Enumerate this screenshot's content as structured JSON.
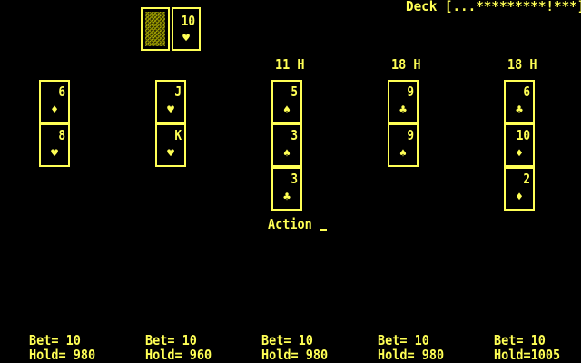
{
  "deck_status": "Deck [...*********!***]",
  "dealer": {
    "hidden_card": "card-back",
    "up_card": {
      "rank": "10",
      "suit": "♥"
    }
  },
  "prompt": {
    "label": "Action"
  },
  "players": [
    {
      "total": "",
      "cards": [
        {
          "rank": "6",
          "suit": "♦"
        },
        {
          "rank": "8",
          "suit": "♥"
        }
      ],
      "bet": "Bet= 10",
      "hold": "Hold= 980"
    },
    {
      "total": "",
      "cards": [
        {
          "rank": "J",
          "suit": "♥"
        },
        {
          "rank": "K",
          "suit": "♥"
        }
      ],
      "bet": "Bet= 10",
      "hold": "Hold= 960"
    },
    {
      "total": "11 H",
      "cards": [
        {
          "rank": "5",
          "suit": "♠"
        },
        {
          "rank": "3",
          "suit": "♠"
        },
        {
          "rank": "3",
          "suit": "♣"
        }
      ],
      "bet": "Bet= 10",
      "hold": "Hold= 980"
    },
    {
      "total": "18 H",
      "cards": [
        {
          "rank": "9",
          "suit": "♣"
        },
        {
          "rank": "9",
          "suit": "♠"
        }
      ],
      "bet": "Bet= 10",
      "hold": "Hold= 980"
    },
    {
      "total": "18 H",
      "cards": [
        {
          "rank": "6",
          "suit": "♣"
        },
        {
          "rank": "10",
          "suit": "♦"
        },
        {
          "rank": "2",
          "suit": "♦"
        }
      ],
      "bet": "Bet= 10",
      "hold": "Hold=1005"
    }
  ],
  "colors": {
    "foreground": "#FFFF55",
    "background": "#000000"
  }
}
